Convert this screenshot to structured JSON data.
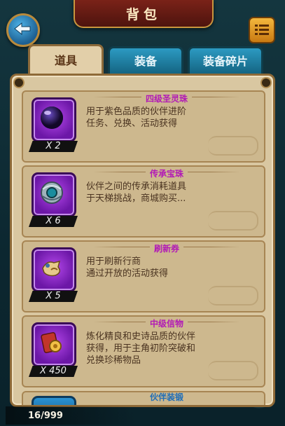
{
  "header": {
    "title": "背包"
  },
  "tabs": [
    {
      "label": "道具",
      "active": true
    },
    {
      "label": "装备",
      "active": false
    },
    {
      "label": "装备碎片",
      "active": false
    }
  ],
  "items": [
    {
      "name": "四级圣灵珠",
      "name_color": "#b21ab6",
      "description": "用于紫色品质的伙伴进阶\n任务、兑换、活动获得",
      "quantity": "X 2",
      "icon": "purple-orb-icon"
    },
    {
      "name": "传承宝珠",
      "name_color": "#b21ab6",
      "description": "伙伴之间的传承消耗道具\n于天梯挑战，商城购买...",
      "quantity": "X 6",
      "icon": "inheritance-orb-icon"
    },
    {
      "name": "刷新券",
      "name_color": "#b21ab6",
      "description": "用于刷新行商\n通过开放的活动获得",
      "quantity": "X 5",
      "icon": "refresh-ticket-icon"
    },
    {
      "name": "中级信物",
      "name_color": "#b21ab6",
      "description": "炼化精良和史诗品质的伙伴获得，用于主角初阶突破和兑换珍稀物品",
      "quantity": "X 450",
      "icon": "token-icon"
    }
  ],
  "partial_item": {
    "name": "伙伴装锻"
  },
  "footer": {
    "capacity": "16/999"
  },
  "colors": {
    "accent_purple": "#b21ab6",
    "tab_active": "#e2cfa9",
    "tab_inactive": "#1f7ea2"
  }
}
